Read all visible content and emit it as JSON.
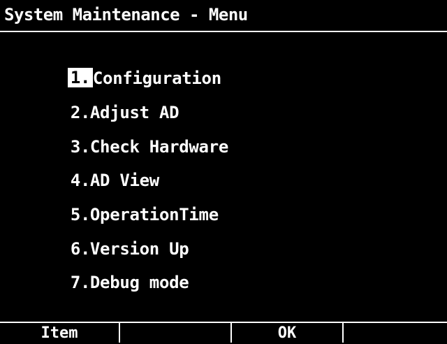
{
  "title": "System Maintenance - Menu",
  "menu": {
    "items": [
      {
        "number": "1.",
        "label": "Configuration"
      },
      {
        "number": "2.",
        "label": "Adjust AD"
      },
      {
        "number": "3.",
        "label": "Check Hardware"
      },
      {
        "number": "4.",
        "label": "AD View"
      },
      {
        "number": "5.",
        "label": "OperationTime"
      },
      {
        "number": "6.",
        "label": "Version Up"
      },
      {
        "number": "7.",
        "label": "Debug mode"
      }
    ],
    "selected_index": 0
  },
  "softkeys": [
    {
      "label": "Item"
    },
    {
      "label": ""
    },
    {
      "label": "OK"
    },
    {
      "label": ""
    }
  ],
  "colors": {
    "background": "#000000",
    "foreground": "#ffffff"
  }
}
